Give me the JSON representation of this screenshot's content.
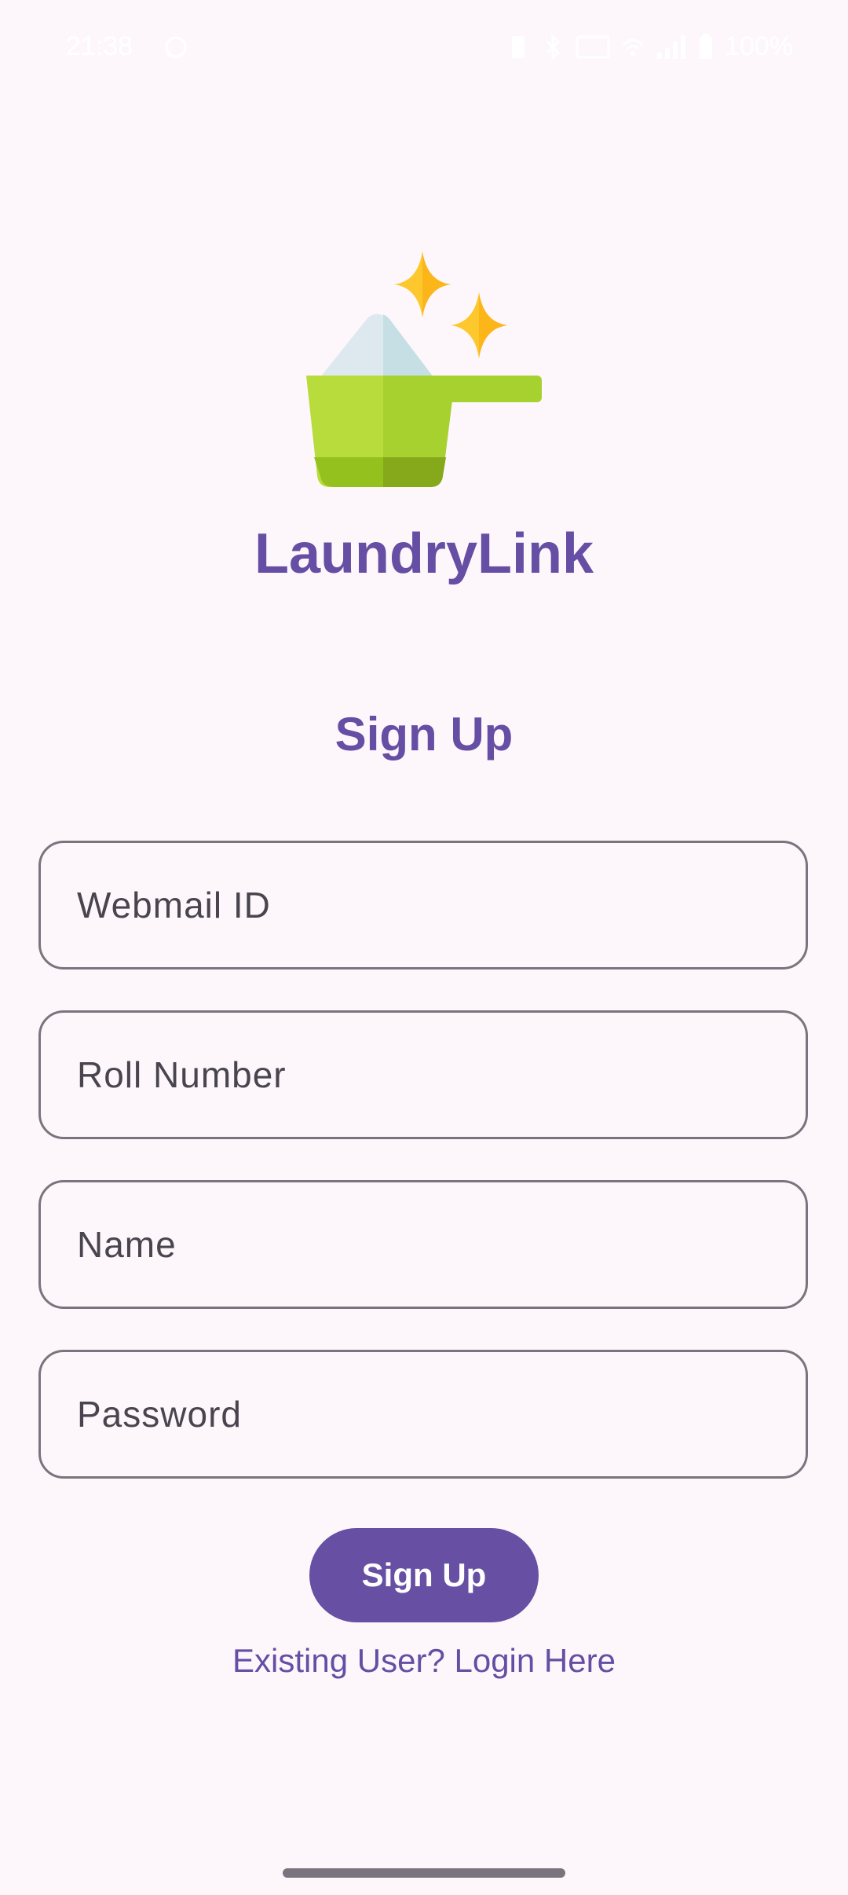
{
  "status_bar": {
    "time": "21:38",
    "battery_text": "100%",
    "icons": [
      "whatsapp-icon",
      "vibrate-icon",
      "bluetooth-icon",
      "volte-icon",
      "wifi-icon",
      "signal-icon",
      "battery-icon"
    ]
  },
  "app": {
    "title": "LaundryLink",
    "logo_icon": "laundry-detergent-scoop-icon"
  },
  "form": {
    "heading": "Sign Up",
    "fields": [
      {
        "label": "Webmail ID"
      },
      {
        "label": "Roll Number"
      },
      {
        "label": "Name"
      },
      {
        "label": "Password"
      }
    ],
    "submit_label": "Sign Up",
    "login_link": "Existing User? Login Here"
  },
  "colors": {
    "background": "#fdf7fc",
    "primary": "#6750a4",
    "title": "#654ea3",
    "outline": "#79747e",
    "field_text": "#49454f"
  }
}
